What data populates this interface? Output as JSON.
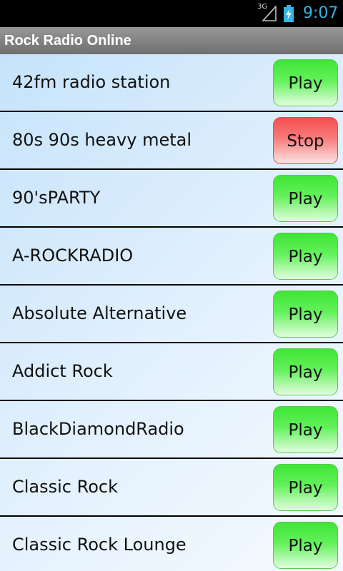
{
  "status": {
    "network": "3G",
    "time": "9:07",
    "clock_color": "#33b5e5"
  },
  "app": {
    "title": "Rock Radio Online"
  },
  "stations": [
    {
      "name": "42fm radio station",
      "button": "Play",
      "state": "stopped"
    },
    {
      "name": "80s 90s heavy metal",
      "button": "Stop",
      "state": "playing"
    },
    {
      "name": "90'sPARTY",
      "button": "Play",
      "state": "stopped"
    },
    {
      "name": "A-ROCKRADIO",
      "button": "Play",
      "state": "stopped"
    },
    {
      "name": "Absolute Alternative",
      "button": "Play",
      "state": "stopped"
    },
    {
      "name": "Addict Rock",
      "button": "Play",
      "state": "stopped"
    },
    {
      "name": "BlackDiamondRadio",
      "button": "Play",
      "state": "stopped"
    },
    {
      "name": "Classic Rock",
      "button": "Play",
      "state": "stopped"
    },
    {
      "name": "Classic Rock Lounge",
      "button": "Play",
      "state": "stopped"
    }
  ],
  "colors": {
    "play_button": "#4cec43",
    "stop_button": "#f45a5a",
    "title_bar": "#838383",
    "list_background": "#d9ecfc"
  }
}
